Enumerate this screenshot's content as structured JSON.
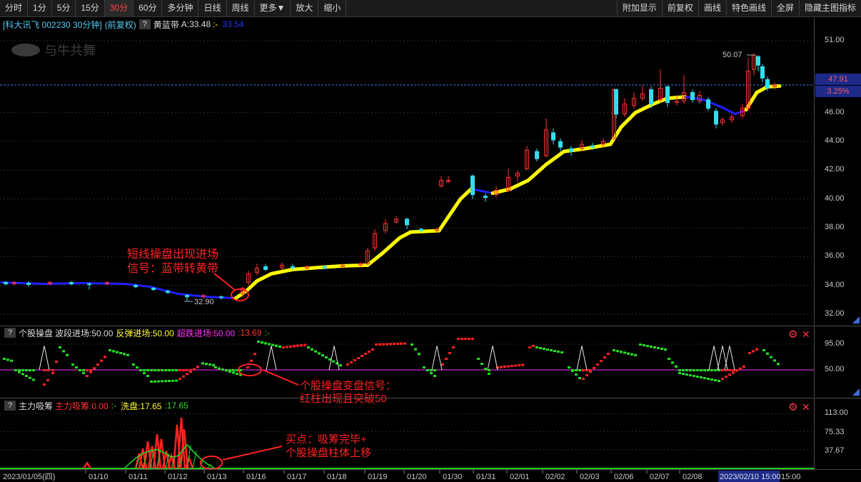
{
  "toolbar": {
    "left": [
      {
        "label": "分时",
        "active": false
      },
      {
        "label": "1分",
        "active": false
      },
      {
        "label": "5分",
        "active": false
      },
      {
        "label": "15分",
        "active": false
      },
      {
        "label": "30分",
        "active": true
      },
      {
        "label": "60分",
        "active": false
      },
      {
        "label": "多分钟",
        "active": false
      },
      {
        "label": "日线",
        "active": false
      },
      {
        "label": "周线",
        "active": false
      },
      {
        "label": "更多▼",
        "active": false
      },
      {
        "label": "放大",
        "active": false
      },
      {
        "label": "缩小",
        "active": false
      }
    ],
    "right": [
      "附加显示",
      "前复权",
      "画线",
      "特色画线",
      "全屏",
      "隐藏主图指标"
    ]
  },
  "main": {
    "stock": "[科大讯飞 002230 30分钟]",
    "adj": "(前复权)",
    "q": "?",
    "ind_name": "黄蓝带",
    "ind_a": "A:33.48",
    "ind_sep": ":-",
    "ind_b": "33.54",
    "watermark": "与牛共舞",
    "price_axis": [
      "51.00",
      "48.00",
      "46.00",
      "44.00",
      "42.00",
      "40.00",
      "38.00",
      "36.00",
      "34.00",
      "32.00"
    ],
    "price_box": "47.91",
    "pct_box": "3.25%",
    "high_label": "50.07",
    "low_label": "32.90",
    "annotation1": [
      "短线操盘出现进场",
      "信号：蓝带转黄带"
    ]
  },
  "panel2": {
    "q": "?",
    "name": "个股操盘",
    "v1": "波段进场:50.00",
    "v2": "反弹进场:50.00",
    "v3": "超跌进场:50.00",
    "v4": ":13.69",
    "v5": ":-",
    "axis": [
      "95.00",
      "50.00"
    ],
    "annotation": [
      "个股操盘变盘信号：",
      "红柱出现且突破50"
    ]
  },
  "panel3": {
    "q": "?",
    "name": "主力吸筹",
    "v1": "主力吸筹:0.00",
    "v2": ":-",
    "v3": "洗盘:17.65",
    "v4": ":17.65",
    "axis": [
      "113.00",
      "75.33",
      "37.67"
    ],
    "annotation": [
      "买点：吸筹完毕+",
      "个股操盘柱体上移"
    ]
  },
  "xaxis": {
    "labels": [
      "2023/01/05(四)",
      "01/10",
      "01/11",
      "01/12",
      "01/13",
      "01/16",
      "01/17",
      "01/18",
      "01/19",
      "01/20",
      "01/30",
      "01/31",
      "02/01",
      "02/02",
      "02/03",
      "02/06",
      "02/07",
      "02/08",
      "2023/02/10 15:00"
    ],
    "tail": "15:00"
  },
  "colors": {
    "up": "#ff3333",
    "down": "#33ddee",
    "yellow": "#ffff00",
    "blue": "#2020ff",
    "green": "#22dd22",
    "magenta": "#ff33ff",
    "red": "#ff2222"
  }
}
